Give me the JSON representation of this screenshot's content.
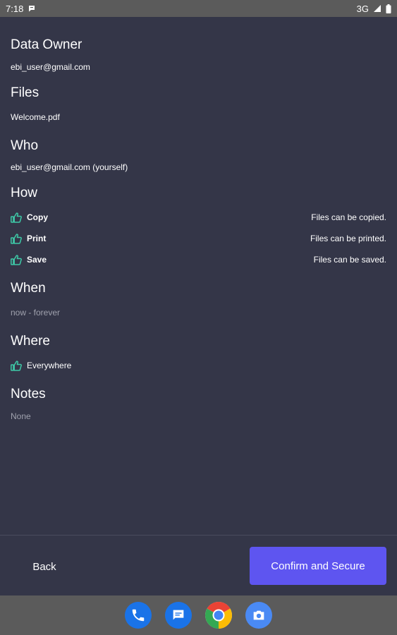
{
  "status_bar": {
    "time": "7:18",
    "network": "3G",
    "icons": [
      "chat-notification-icon",
      "signal-icon",
      "battery-icon"
    ]
  },
  "sections": {
    "data_owner": {
      "title": "Data Owner",
      "value": "ebi_user@gmail.com"
    },
    "files": {
      "title": "Files",
      "value": "Welcome.pdf"
    },
    "who": {
      "title": "Who",
      "value": "ebi_user@gmail.com (yourself)"
    },
    "how": {
      "title": "How",
      "permissions": [
        {
          "label": "Copy",
          "description": "Files can be copied.",
          "icon": "thumbs-up-icon"
        },
        {
          "label": "Print",
          "description": "Files can be printed.",
          "icon": "thumbs-up-icon"
        },
        {
          "label": "Save",
          "description": "Files can be saved.",
          "icon": "thumbs-up-icon"
        }
      ]
    },
    "when": {
      "title": "When",
      "value": "now - forever"
    },
    "where": {
      "title": "Where",
      "value": "Everywhere",
      "icon": "thumbs-up-icon"
    },
    "notes": {
      "title": "Notes",
      "value": "None"
    }
  },
  "actions": {
    "back_label": "Back",
    "confirm_label": "Confirm and Secure"
  },
  "dock": {
    "apps": [
      "phone-app-icon",
      "messages-app-icon",
      "chrome-app-icon",
      "camera-app-icon"
    ]
  },
  "colors": {
    "background": "#343648",
    "accent": "#5e55f0",
    "icon_green": "#3ec9a7",
    "muted_text": "#9fa1ad",
    "system_bar": "#5b5b5b"
  }
}
